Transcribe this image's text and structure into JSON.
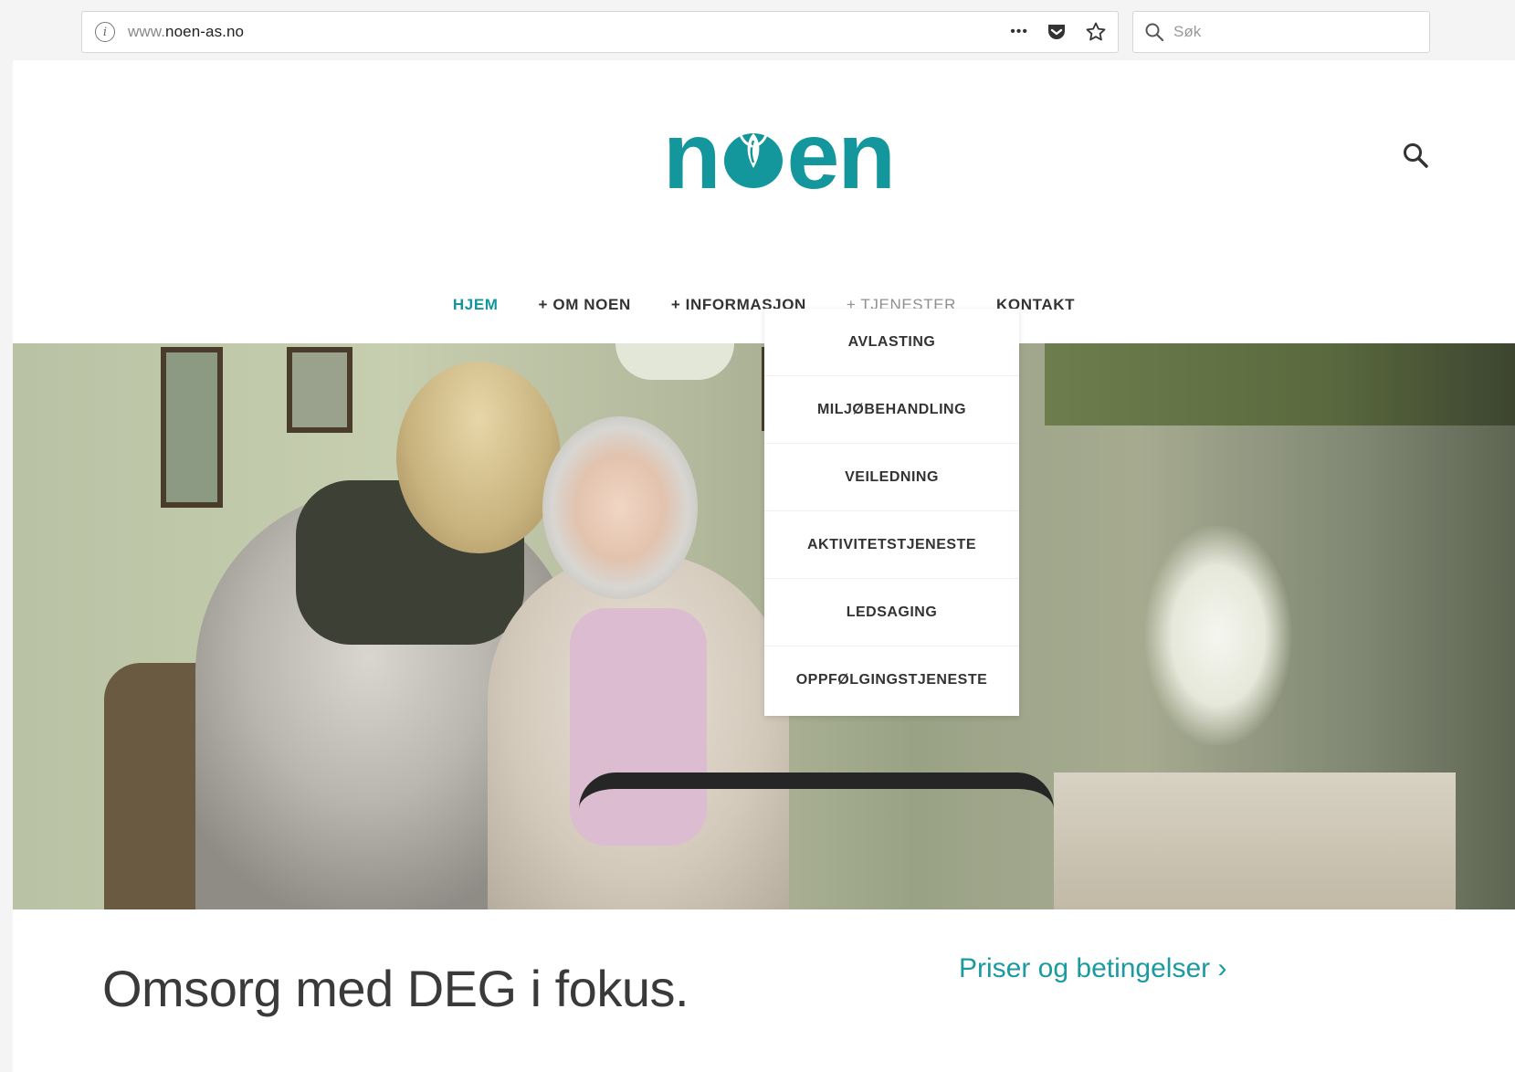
{
  "browser": {
    "url_prefix": "www.",
    "url_domain": "noen-as.no",
    "search_placeholder": "Søk",
    "actions_menu": "•••"
  },
  "site": {
    "logo_text_left": "n",
    "logo_text_right": "en",
    "brand_color": "#14979c"
  },
  "nav": {
    "items": [
      {
        "label": "HJEM",
        "state": "active"
      },
      {
        "label": "+ OM NOEN"
      },
      {
        "label": "+ INFORMASJON"
      },
      {
        "label": "+ TJENESTER",
        "state": "hover"
      },
      {
        "label": "KONTAKT"
      }
    ]
  },
  "dropdown": {
    "items": [
      "AVLASTING",
      "MILJØBEHANDLING",
      "VEILEDNING",
      "AKTIVITETSTJENESTE",
      "LEDSAGING",
      "OPPFØLGINGSTJENESTE"
    ]
  },
  "content": {
    "headline": "Omsorg med DEG i fokus.",
    "pricing_link": "Priser og betingelser ›"
  },
  "icons": {
    "info": "info-icon",
    "pocket": "pocket-icon",
    "bookmark": "star-icon",
    "search": "search-icon"
  }
}
